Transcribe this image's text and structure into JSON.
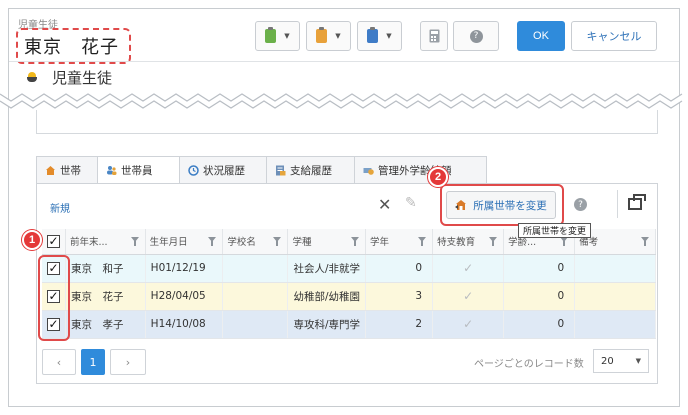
{
  "header": {
    "subtitle": "児童生徒",
    "name": "東京　花子",
    "page_title": "児童生徒",
    "ok_label": "OK",
    "cancel_label": "キャンセル",
    "colors": {
      "primary": "#2f8bdb",
      "highlight": "#e04a4a"
    }
  },
  "tabs": [
    {
      "label": "世帯",
      "icon": "home-icon"
    },
    {
      "label": "世帯員",
      "icon": "people-icon"
    },
    {
      "label": "状況履歴",
      "icon": "clock-icon"
    },
    {
      "label": "支給履歴",
      "icon": "document-icon"
    },
    {
      "label": "管理外学齢給額",
      "icon": "money-icon"
    }
  ],
  "toolbar": {
    "new_label": "新規",
    "move_household_label": "所属世帯を変更",
    "tooltip": "所属世帯を変更"
  },
  "badges": {
    "one": "1",
    "two": "2"
  },
  "table": {
    "columns": [
      "前年末...",
      "生年月日",
      "学校名",
      "学種",
      "学年",
      "特支教育",
      "学齢...",
      "備考"
    ],
    "rows": [
      {
        "checked": "✓",
        "prev_year_name": "東京　和子",
        "birthdate": "H01/12/19",
        "school": "",
        "school_type": "社会人/非就学",
        "grade": "0",
        "special_needs": "✓",
        "amount": "0",
        "note": ""
      },
      {
        "checked": "✓",
        "prev_year_name": "東京　花子",
        "birthdate": "H28/04/05",
        "school": "",
        "school_type": "幼稚部/幼稚園",
        "grade": "3",
        "special_needs": "✓",
        "amount": "0",
        "note": ""
      },
      {
        "checked": "✓",
        "prev_year_name": "東京　孝子",
        "birthdate": "H14/10/08",
        "school": "",
        "school_type": "専攻科/専門学",
        "grade": "2",
        "special_needs": "✓",
        "amount": "0",
        "note": ""
      }
    ],
    "header_checkbox": "✓"
  },
  "pager": {
    "prev": "‹",
    "current_page": "1",
    "next": "›",
    "per_page_label": "ページごとのレコード数",
    "per_page_value": "20"
  }
}
